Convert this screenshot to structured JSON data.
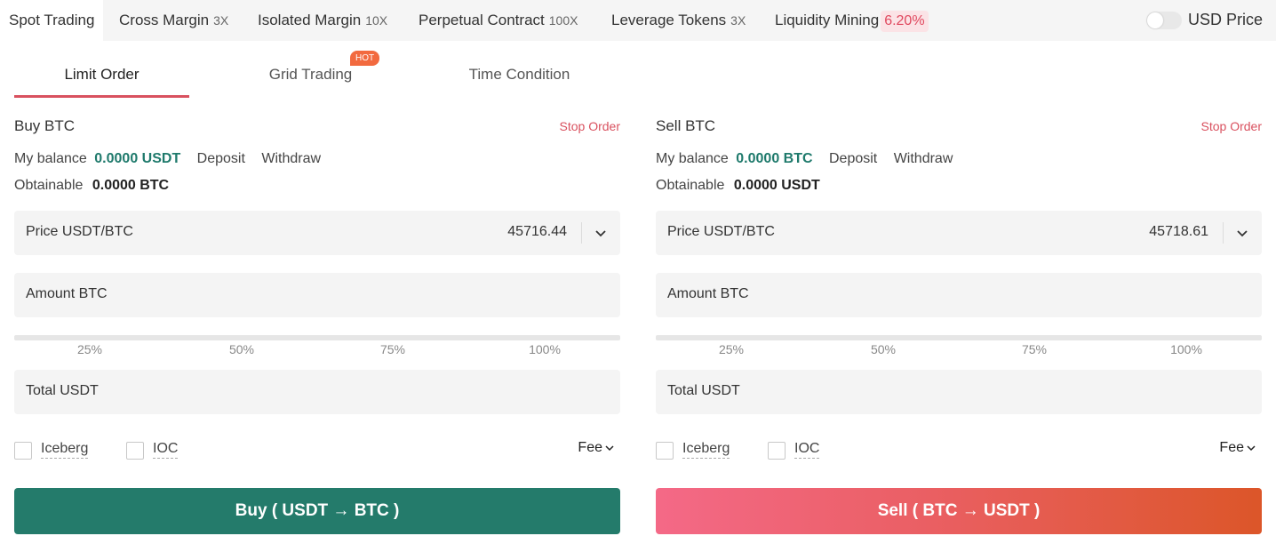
{
  "top_tabs": [
    {
      "label": "Spot Trading",
      "mult": ""
    },
    {
      "label": "Cross Margin",
      "mult": "3X"
    },
    {
      "label": "Isolated Margin",
      "mult": "10X"
    },
    {
      "label": "Perpetual Contract",
      "mult": "100X"
    },
    {
      "label": "Leverage Tokens",
      "mult": "3X"
    },
    {
      "label": "Liquidity Mining",
      "rate": "6.20%"
    }
  ],
  "usd_price_label": "USD Price",
  "order_tabs": [
    "Limit Order",
    "Grid Trading",
    "Time Condition"
  ],
  "hot_badge": "HOT",
  "colors": {
    "accent": "#d9515f",
    "buy": "#247b6b",
    "teal_text": "#1f7a6c",
    "sell_start": "#f46987",
    "sell_end": "#dc5629"
  },
  "buy": {
    "title": "Buy BTC",
    "stop_order": "Stop Order",
    "balance_label": "My balance",
    "balance_value": "0.0000 USDT",
    "deposit": "Deposit",
    "withdraw": "Withdraw",
    "obtainable_label": "Obtainable",
    "obtainable_value": "0.0000 BTC",
    "price_label": "Price USDT/BTC",
    "price_value": "45716.44",
    "amount_label": "Amount BTC",
    "total_label": "Total USDT",
    "iceberg": "Iceberg",
    "ioc": "IOC",
    "fee": "Fee",
    "button": "Buy ( USDT → BTC )"
  },
  "sell": {
    "title": "Sell BTC",
    "stop_order": "Stop Order",
    "balance_label": "My balance",
    "balance_value": "0.0000 BTC",
    "deposit": "Deposit",
    "withdraw": "Withdraw",
    "obtainable_label": "Obtainable",
    "obtainable_value": "0.0000 USDT",
    "price_label": "Price USDT/BTC",
    "price_value": "45718.61",
    "amount_label": "Amount BTC",
    "total_label": "Total USDT",
    "iceberg": "Iceberg",
    "ioc": "IOC",
    "fee": "Fee",
    "button": "Sell ( BTC → USDT )"
  },
  "percent_marks": [
    "25%",
    "50%",
    "75%",
    "100%"
  ]
}
